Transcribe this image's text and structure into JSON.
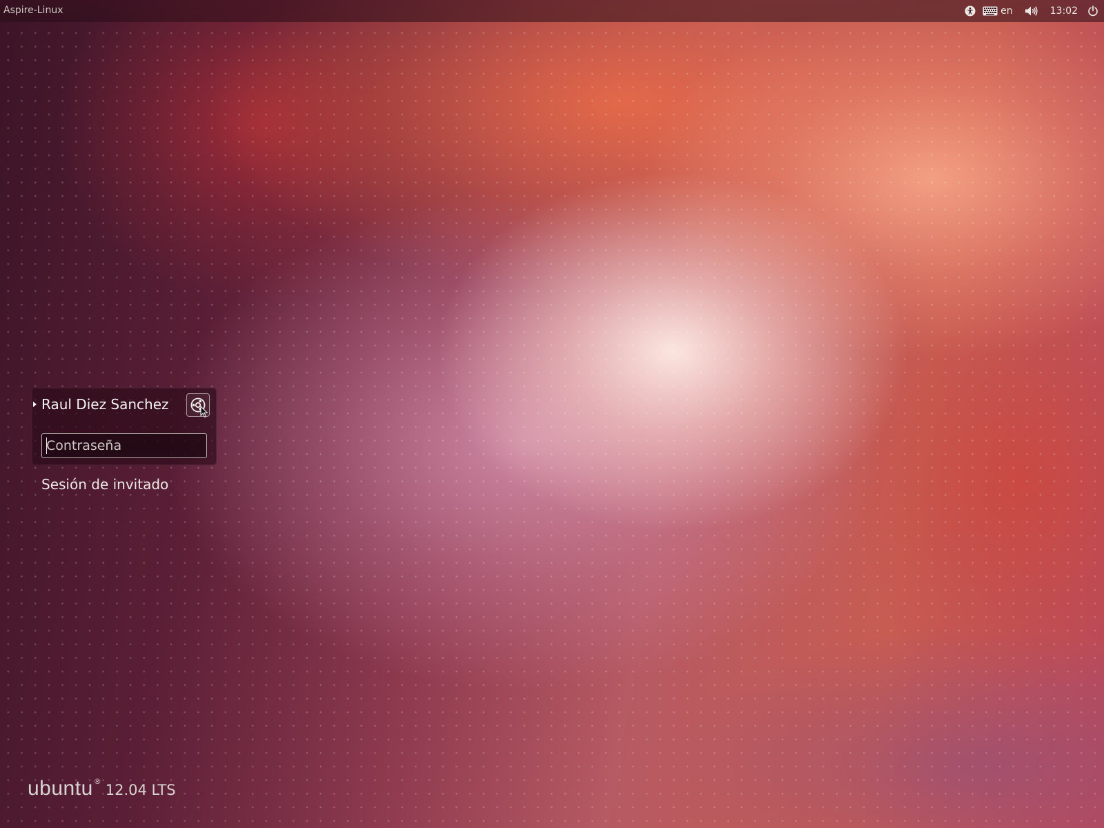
{
  "top_panel": {
    "hostname": "Aspire-Linux",
    "keyboard_layout": "en",
    "clock": "13:02",
    "icons": [
      "accessibility-icon",
      "keyboard-icon",
      "volume-icon",
      "power-icon"
    ]
  },
  "login": {
    "user_name": "Raul Diez Sanchez",
    "password_placeholder": "Contraseña",
    "password_value": "",
    "session_icon": "session-selector-icon",
    "guest_session": "Sesión de invitado"
  },
  "branding": {
    "word": "ubuntu",
    "registered": "®",
    "version": "12.04 LTS"
  },
  "colors": {
    "panel_text": "#ece8e4",
    "login_box": "#280a16",
    "wallpaper_accent": "#e0603a"
  }
}
